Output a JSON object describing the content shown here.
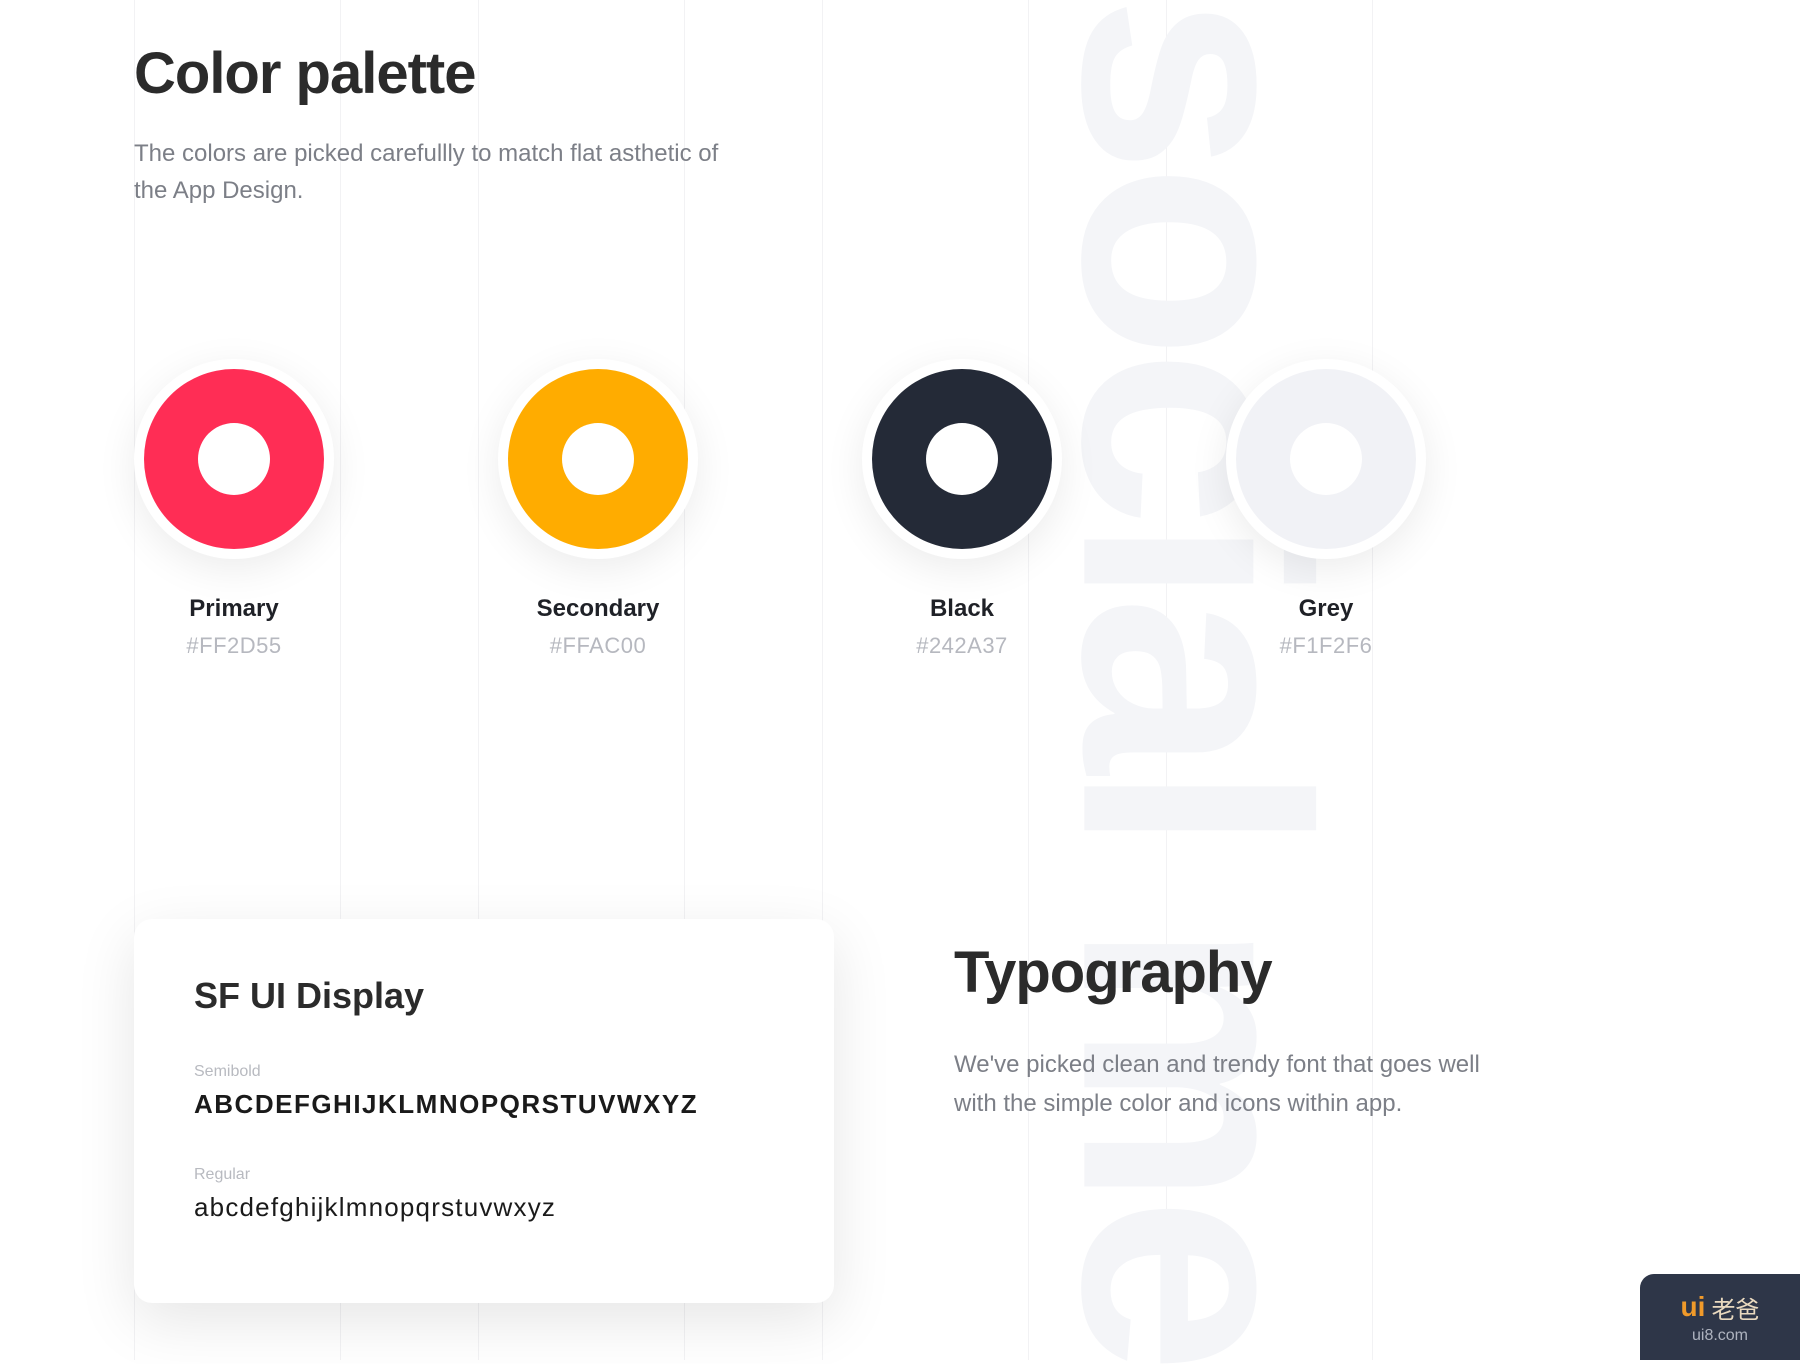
{
  "ghost_word": "social me",
  "palette": {
    "title": "Color palette",
    "description": "The colors are picked carefullly to match flat asthetic of the App Design.",
    "items": [
      {
        "name": "Primary",
        "hex": "#FF2D55",
        "fill": "#FF2D55"
      },
      {
        "name": "Secondary",
        "hex": "#FFAC00",
        "fill": "#FFAC00"
      },
      {
        "name": "Black",
        "hex": "#242A37",
        "fill": "#242A37"
      },
      {
        "name": "Grey",
        "hex": "#F1F2F6",
        "fill": "#F1F2F6"
      }
    ]
  },
  "type_card": {
    "font_name": "SF UI Display",
    "weights": [
      {
        "label": "Semibold",
        "sample": "ABCDEFGHIJKLMNOPQRSTUVWXYZ"
      },
      {
        "label": "Regular",
        "sample": "abcdefghijklmnopqrstuvwxyz"
      }
    ]
  },
  "typography": {
    "title": "Typography",
    "description": "We've picked clean and trendy font that goes well with the simple color and icons within app."
  },
  "badge": {
    "brand": "ui",
    "cn": "老爸",
    "url": "ui8.com"
  }
}
